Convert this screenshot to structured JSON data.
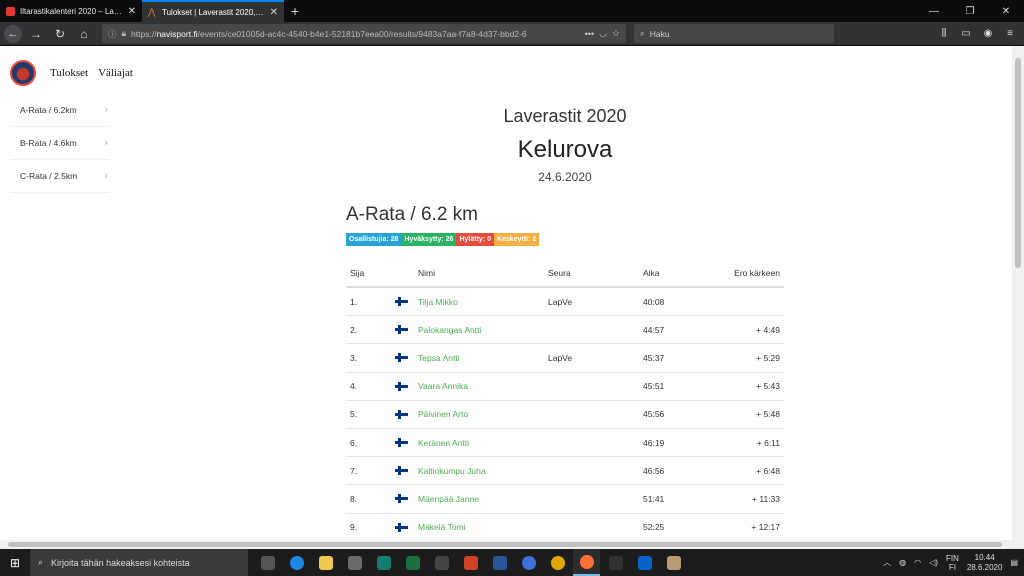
{
  "browser": {
    "tabs": [
      {
        "title": "Iltarastikalenteri 2020 – Lapin V",
        "favicon_color": "#e53935",
        "active": false
      },
      {
        "title": "Tulokset | Laverastit 2020, Kelu",
        "favicon_color": "#e67e22",
        "active": true
      }
    ],
    "url_prefix": "https://",
    "url_domain": "navisport.fi",
    "url_path": "/events/ce01005d-ac4c-4540-b4e1-52181b7eea00/results/9483a7aa-f7a8-4d37-bbd2-6",
    "url_actions": "•••",
    "search_placeholder": "Haku"
  },
  "site": {
    "nav": [
      "Tulokset",
      "Väliajat"
    ]
  },
  "sidebar": {
    "items": [
      {
        "label": "A-Rata / 6.2km"
      },
      {
        "label": "B-Rata / 4.6km"
      },
      {
        "label": "C-Rata / 2.5km"
      }
    ]
  },
  "event": {
    "title": "Laverastit 2020",
    "place": "Kelurova",
    "date": "24.6.2020"
  },
  "course": {
    "name": "A-Rata / 6.2 km",
    "badges": [
      {
        "label": "Osallistujia: 28",
        "color": "#29a3d6"
      },
      {
        "label": "Hyväksytty: 26",
        "color": "#28b463"
      },
      {
        "label": "Hylätty: 0",
        "color": "#e74c3c"
      },
      {
        "label": "Keskeytti: 2",
        "color": "#f5b041"
      }
    ]
  },
  "results": {
    "headers": {
      "pos": "Sija",
      "name": "Nimi",
      "club": "Seura",
      "time": "Aika",
      "diff": "Ero kärkeen"
    },
    "rows": [
      {
        "pos": "1.",
        "name": "Tilja Mikko",
        "club": "LapVe",
        "time": "40:08",
        "diff": ""
      },
      {
        "pos": "2.",
        "name": "Palokangas Antti",
        "club": "",
        "time": "44:57",
        "diff": "+ 4:49"
      },
      {
        "pos": "3.",
        "name": "Tepsa Antti",
        "club": "LapVe",
        "time": "45:37",
        "diff": "+ 5:29"
      },
      {
        "pos": "4.",
        "name": "Vaara Annika",
        "club": "",
        "time": "45:51",
        "diff": "+ 5:43"
      },
      {
        "pos": "5.",
        "name": "Päivinen Arto",
        "club": "",
        "time": "45:56",
        "diff": "+ 5:48"
      },
      {
        "pos": "6.",
        "name": "Keränen Antti",
        "club": "",
        "time": "46:19",
        "diff": "+ 6:11"
      },
      {
        "pos": "7.",
        "name": "Kaltiokumpu Juha",
        "club": "",
        "time": "46:56",
        "diff": "+ 6:48"
      },
      {
        "pos": "8.",
        "name": "Mäenpää Janne",
        "club": "",
        "time": "51:41",
        "diff": "+ 11:33"
      },
      {
        "pos": "9.",
        "name": "Mäkelä Tomi",
        "club": "",
        "time": "52:25",
        "diff": "+ 12:17"
      }
    ]
  },
  "taskbar": {
    "search_placeholder": "Kirjoita tähän hakeaksesi kohteista",
    "apps": [
      {
        "name": "task-view",
        "color": "#555555"
      },
      {
        "name": "edge",
        "color": "#1e88e5"
      },
      {
        "name": "file-explorer",
        "color": "#f2c94c"
      },
      {
        "name": "store",
        "color": "#6a6a6a"
      },
      {
        "name": "publisher",
        "color": "#127c6e"
      },
      {
        "name": "excel",
        "color": "#1d7044"
      },
      {
        "name": "onenote",
        "color": "#444444"
      },
      {
        "name": "powerpoint",
        "color": "#d04423"
      },
      {
        "name": "word",
        "color": "#2b579a"
      },
      {
        "name": "app-a",
        "color": "#3f6fd8"
      },
      {
        "name": "chrome",
        "color": "#e0a800"
      },
      {
        "name": "firefox",
        "color": "#ff7139"
      },
      {
        "name": "terminal",
        "color": "#333333"
      },
      {
        "name": "mail",
        "color": "#0a63c9"
      },
      {
        "name": "notepad",
        "color": "#b89b72"
      }
    ],
    "lang_top": "FIN",
    "lang_bottom": "FI",
    "time": "10.44",
    "date": "28.6.2020"
  }
}
